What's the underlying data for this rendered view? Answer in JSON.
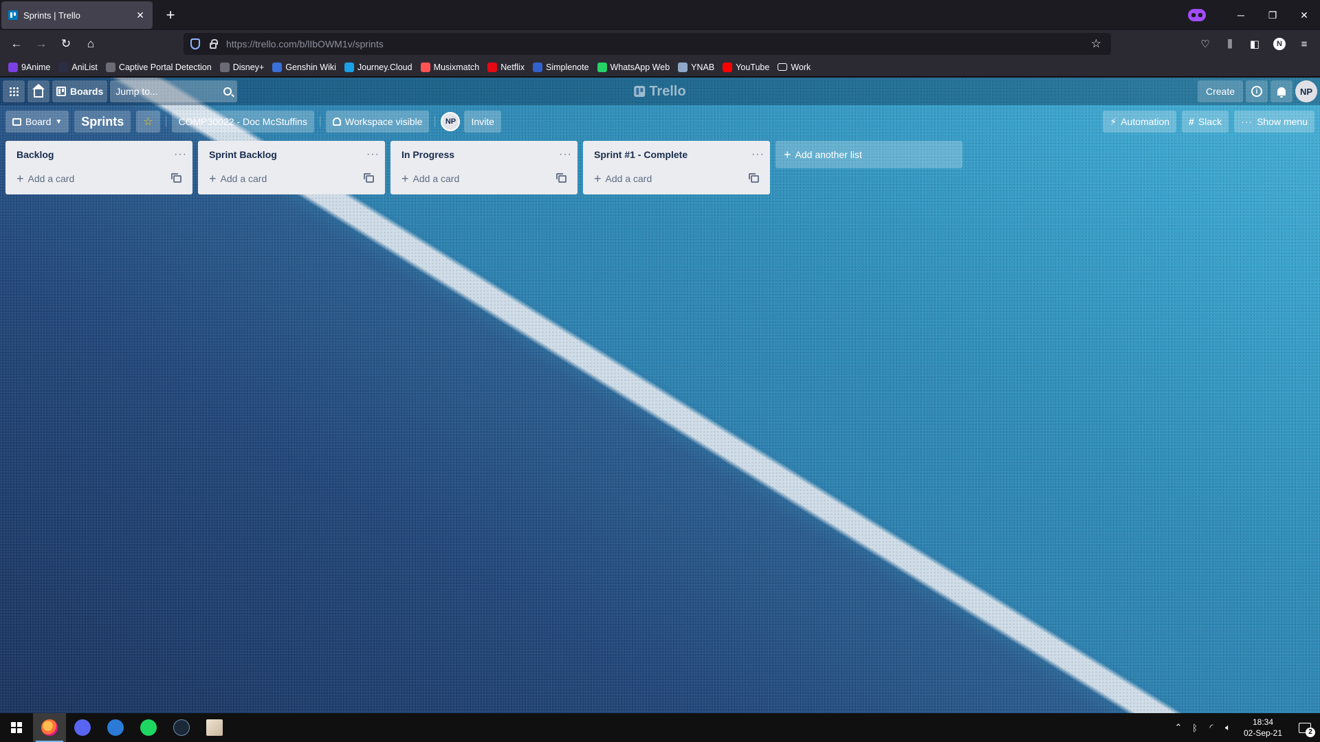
{
  "browser": {
    "tab_title": "Sprints | Trello",
    "url": "https://trello.com/b/lIbOWM1v/sprints",
    "profile_initial": "N",
    "bookmarks": [
      {
        "label": "9Anime",
        "icon_color": "#7b3fe4"
      },
      {
        "label": "AniList",
        "icon_color": "#2b2d42"
      },
      {
        "label": "Captive Portal Detection",
        "icon_color": "#6b6b75"
      },
      {
        "label": "Disney+",
        "icon_color": "#6b6b75"
      },
      {
        "label": "Genshin Wiki",
        "icon_color": "#3b6fd8"
      },
      {
        "label": "Journey.Cloud",
        "icon_color": "#1aa0e6"
      },
      {
        "label": "Musixmatch",
        "icon_color": "#ff5353"
      },
      {
        "label": "Netflix",
        "icon_color": "#e50914"
      },
      {
        "label": "Simplenote",
        "icon_color": "#3361cc"
      },
      {
        "label": "WhatsApp Web",
        "icon_color": "#25d366"
      },
      {
        "label": "YNAB",
        "icon_color": "#8fa8c8"
      },
      {
        "label": "YouTube",
        "icon_color": "#ff0000"
      },
      {
        "label": "Work",
        "icon_color": "#2b2a33"
      }
    ]
  },
  "trello": {
    "header": {
      "boards_label": "Boards",
      "jump_placeholder": "Jump to...",
      "logo_text": "Trello",
      "create_label": "Create",
      "user_initials": "NP"
    },
    "board": {
      "view_label": "Board",
      "title": "Sprints",
      "workspace": "COMP30022 - Doc McStuffins",
      "visibility": "Workspace visible",
      "member_initials": "NP",
      "invite_label": "Invite",
      "automation_label": "Automation",
      "slack_label": "Slack",
      "show_menu_label": "Show menu"
    },
    "lists": [
      {
        "title": "Backlog",
        "add_card": "Add a card"
      },
      {
        "title": "Sprint Backlog",
        "add_card": "Add a card"
      },
      {
        "title": "In Progress",
        "add_card": "Add a card"
      },
      {
        "title": "Sprint #1 - Complete",
        "add_card": "Add a card"
      }
    ],
    "add_list_label": "Add another list"
  },
  "taskbar": {
    "time": "18:34",
    "date": "02-Sep-21",
    "notification_count": "2"
  }
}
